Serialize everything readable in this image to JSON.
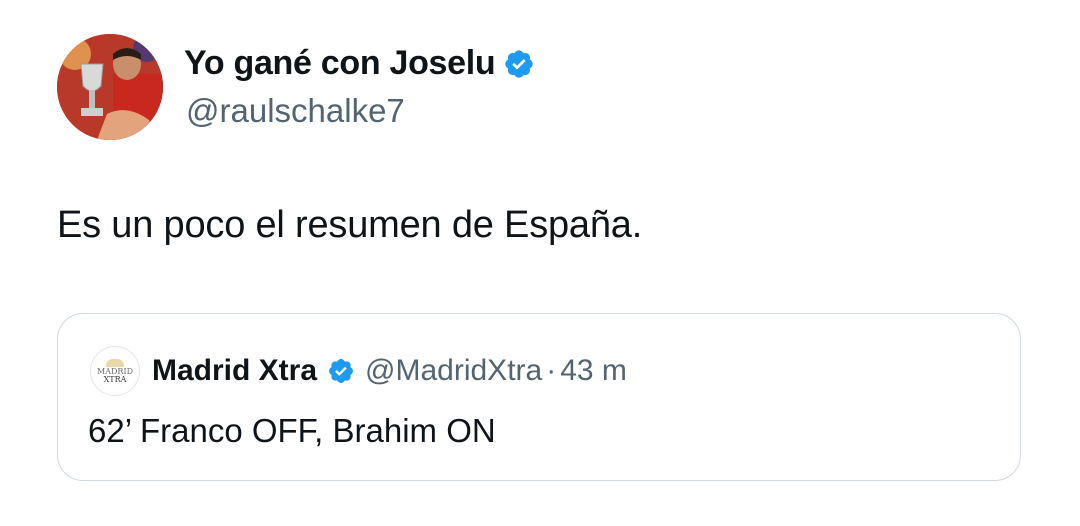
{
  "colors": {
    "verified_blue": "#1d9bf0",
    "secondary_text": "#536471",
    "card_border": "#cfd9de"
  },
  "tweet": {
    "author": {
      "display_name": "Yo gané con Joselu",
      "handle": "@raulschalke7",
      "verified_icon": "verified-badge-icon"
    },
    "text": "Es un poco el resumen de España."
  },
  "quoted_tweet": {
    "author": {
      "display_name": "Madrid Xtra",
      "handle": "@MadridXtra",
      "verified_icon": "verified-badge-icon",
      "avatar_logo_line1": "MADRID",
      "avatar_logo_line2": "XTRA"
    },
    "separator": "·",
    "time": "43 m",
    "text": "62’ Franco OFF, Brahim ON"
  }
}
